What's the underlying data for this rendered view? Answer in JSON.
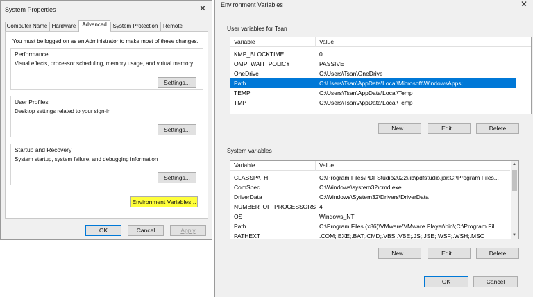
{
  "system_properties": {
    "title": "System Properties",
    "tabs": [
      "Computer Name",
      "Hardware",
      "Advanced",
      "System Protection",
      "Remote"
    ],
    "admin_note": "You must be logged on as an Administrator to make most of these changes.",
    "performance": {
      "title": "Performance",
      "description": "Visual effects, processor scheduling, memory usage, and virtual memory",
      "button": "Settings..."
    },
    "user_profiles": {
      "title": "User Profiles",
      "description": "Desktop settings related to your sign-in",
      "button": "Settings..."
    },
    "startup_recovery": {
      "title": "Startup and Recovery",
      "description": "System startup, system failure, and debugging information",
      "button": "Settings..."
    },
    "env_button": "Environment Variables...",
    "ok": "OK",
    "cancel": "Cancel",
    "apply": "Apply"
  },
  "environment_variables": {
    "title": "Environment Variables",
    "user_section_label": "User variables for Tsan",
    "system_section_label": "System variables",
    "col_variable": "Variable",
    "col_value": "Value",
    "user_rows": [
      {
        "variable": "KMP_BLOCKTIME",
        "value": "0"
      },
      {
        "variable": "OMP_WAIT_POLICY",
        "value": "PASSIVE"
      },
      {
        "variable": "OneDrive",
        "value": "C:\\Users\\Tsan\\OneDrive"
      },
      {
        "variable": "Path",
        "value": "C:\\Users\\Tsan\\AppData\\Local\\Microsoft\\WindowsApps;"
      },
      {
        "variable": "TEMP",
        "value": "C:\\Users\\Tsan\\AppData\\Local\\Temp"
      },
      {
        "variable": "TMP",
        "value": "C:\\Users\\Tsan\\AppData\\Local\\Temp"
      }
    ],
    "system_rows": [
      {
        "variable": "CLASSPATH",
        "value": "C:\\Program Files\\PDFStudio2022\\lib\\pdfstudio.jar;C:\\Program Files..."
      },
      {
        "variable": "ComSpec",
        "value": "C:\\Windows\\system32\\cmd.exe"
      },
      {
        "variable": "DriverData",
        "value": "C:\\Windows\\System32\\Drivers\\DriverData"
      },
      {
        "variable": "NUMBER_OF_PROCESSORS",
        "value": "4"
      },
      {
        "variable": "OS",
        "value": "Windows_NT"
      },
      {
        "variable": "Path",
        "value": "C:\\Program Files (x86)\\VMware\\VMware Player\\bin\\;C:\\Program Fil..."
      },
      {
        "variable": "PATHEXT",
        "value": ".COM;.EXE;.BAT;.CMD;.VBS;.VBE;.JS;.JSE;.WSF;.WSH;.MSC"
      }
    ],
    "user_buttons": {
      "new": "New...",
      "edit": "Edit...",
      "delete": "Delete"
    },
    "system_buttons": {
      "new": "New...",
      "edit": "Edit...",
      "delete": "Delete"
    },
    "ok": "OK",
    "cancel": "Cancel"
  },
  "colors": {
    "selection": "#0078d7",
    "highlighter": "#ffff3b"
  }
}
